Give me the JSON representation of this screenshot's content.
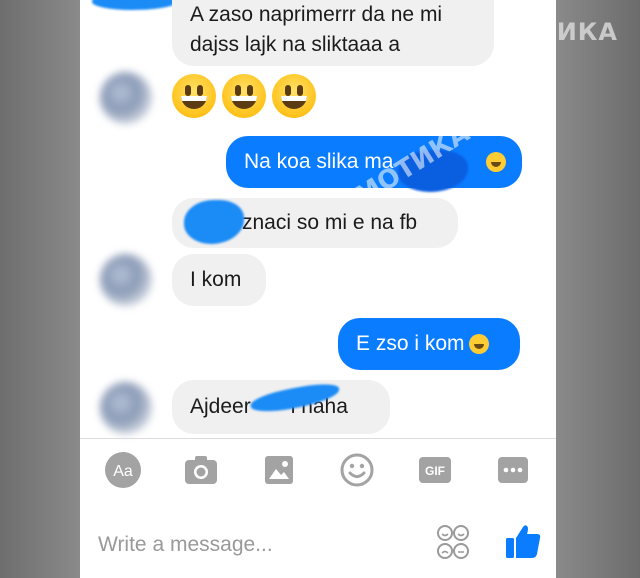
{
  "watermark": "МОТИКА",
  "watermark_diag": "МОТИКА",
  "messages": {
    "m1": "A zaso naprimerrr da ne mi dajss lajk na sliktaaa a",
    "m1_line1": "A zaso naprimerrr da ne mi",
    "m1_line2": "dajss lajk na sliktaaa a",
    "m3": "Na koa slika ma",
    "m4": "znaci so mi e na fb",
    "m5": "I kom",
    "m6": "E zso i kom",
    "m7_part1": "Ajdeer",
    "m7_part2": "i naha"
  },
  "toolbar": {
    "aa_label": "Aa",
    "gif_label": "GIF"
  },
  "composer": {
    "placeholder": "Write a message..."
  },
  "colors": {
    "outgoing": "#0a7cff",
    "incoming": "#f1f0f0",
    "icon": "#9a9a9a",
    "like": "#0a7cff"
  }
}
